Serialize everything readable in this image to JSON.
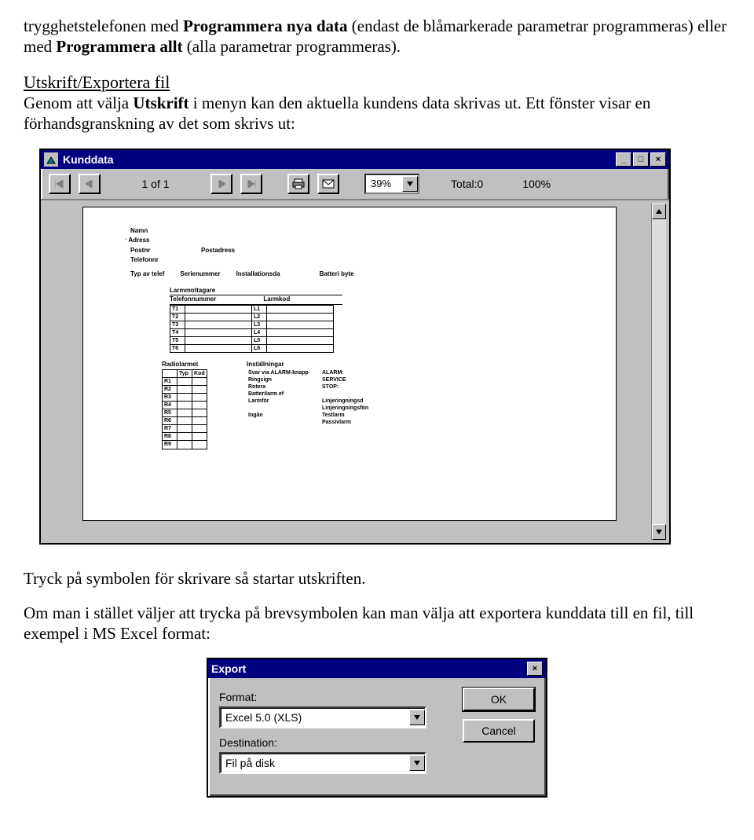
{
  "paragraphs": {
    "p1_a": "trygghetstelefonen med ",
    "p1_b1": "Programmera nya data ",
    "p1_c": "(endast de blåmarkerade parametrar programmeras) eller med ",
    "p1_b2": "Programmera allt ",
    "p1_d": "(alla parametrar programmeras).",
    "h1": "Utskrift/Exportera fil",
    "p2_a": "Genom att välja ",
    "p2_b": "Utskrift",
    "p2_c": " i menyn kan den aktuella kundens data skrivas ut. Ett fönster visar en förhandsgranskning av det som skrivs ut:",
    "p3": "Tryck på symbolen för skrivare så startar utskriften.",
    "p4": "Om man i stället väljer att trycka på brevsymbolen kan man välja att exportera kunddata till en fil, till exempel i MS Excel format:"
  },
  "kunddata": {
    "title": "Kunddata",
    "page_indicator": "1 of 1",
    "zoom": "39%",
    "total": "Total:0",
    "percent": "100%",
    "preview": {
      "namn": "Namn",
      "adress": "Adress",
      "postnr": "Postnr",
      "postadress": "Postadress",
      "telefonnr": "Telefonnr",
      "typ_av_telef": "Typ av telef",
      "serienummer": "Serienummer",
      "installationsda": "Installationsda",
      "batteri_byte": "Batteri byte",
      "larmmottagare": "Larmmottagare",
      "telefonnummer": "Telefonnummer",
      "larmkod": "Larmkod",
      "rows_t": [
        "T1",
        "T2",
        "T3",
        "T4",
        "T5",
        "T6"
      ],
      "rows_l": [
        "L1",
        "L2",
        "L3",
        "L4",
        "L5",
        "L6"
      ],
      "radiolarmet": "Radiolarmet",
      "installningar": "Inställningar",
      "typ": "Typ",
      "kod": "Kod",
      "rows_r": [
        "R1",
        "R2",
        "R3",
        "R4",
        "R5",
        "R6",
        "R7",
        "R8",
        "R9"
      ],
      "settings": [
        [
          "Svar via ALARM-knapp",
          "ALARM:"
        ],
        [
          "Ringsign",
          "SERVICE"
        ],
        [
          "Rotera",
          "STOP:"
        ],
        [
          "Batterilarm ef",
          ""
        ],
        [
          "Larmför",
          "Linjeringningsd"
        ],
        [
          "",
          "Linjeringningsfön"
        ],
        [
          "Ingån",
          "Testlarm"
        ],
        [
          "",
          "Passivlarm"
        ]
      ]
    }
  },
  "export": {
    "title": "Export",
    "format_label": "Format:",
    "format_value": "Excel 5.0 (XLS)",
    "dest_label": "Destination:",
    "dest_value": "Fil på disk",
    "ok": "OK",
    "cancel": "Cancel"
  }
}
